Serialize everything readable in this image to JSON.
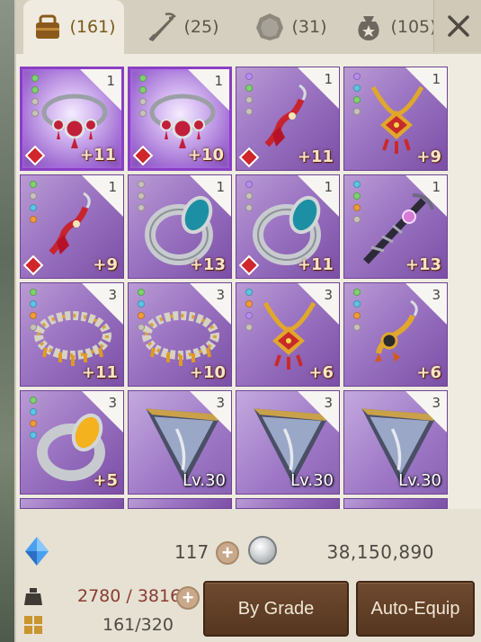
{
  "tabs": [
    {
      "icon": "bag-icon",
      "count": "(161)",
      "active": true
    },
    {
      "icon": "weapon-icon",
      "count": "(25)",
      "active": false
    },
    {
      "icon": "emblem-icon",
      "count": "(31)",
      "active": false
    },
    {
      "icon": "pouch-icon",
      "count": "(105)",
      "active": false
    }
  ],
  "items": [
    {
      "kind": "necklace",
      "qty": "1",
      "enh": "+11",
      "dots": [
        "#7fd36f",
        "#7fd36f",
        "#c9c2bc",
        "#c9c2bc"
      ],
      "gem": true,
      "selected": true
    },
    {
      "kind": "necklace",
      "qty": "1",
      "enh": "+10",
      "dots": [
        "#7fd36f",
        "#7fd36f",
        "#c9c2bc",
        "#c9c2bc"
      ],
      "gem": true,
      "selected": true
    },
    {
      "kind": "earring",
      "qty": "1",
      "enh": "+11",
      "dots": [
        "#b98cf4",
        "#7fd36f",
        "#c9c2bc",
        "#c9c2bc"
      ],
      "gem": true,
      "selected": false
    },
    {
      "kind": "pendant",
      "qty": "1",
      "enh": "+9",
      "dots": [
        "#b98cf4",
        "#5cc6e6",
        "#7fd36f",
        "#c9c2bc"
      ],
      "gem": false,
      "selected": false
    },
    {
      "kind": "earring",
      "qty": "1",
      "enh": "+9",
      "dots": [
        "#7fd36f",
        "#c9c2bc",
        "#5cc6e6",
        "#f39a3c"
      ],
      "gem": true,
      "selected": false
    },
    {
      "kind": "ring",
      "qty": "1",
      "enh": "+13",
      "dots": [
        "#c9c2bc",
        "#c9c2bc",
        "#c9c2bc"
      ],
      "gem": false,
      "selected": false
    },
    {
      "kind": "ring",
      "qty": "1",
      "enh": "+11",
      "dots": [
        "#b98cf4",
        "#c9c2bc",
        "#c9c2bc"
      ],
      "gem": true,
      "selected": false
    },
    {
      "kind": "staff",
      "qty": "1",
      "enh": "+13",
      "dots": [
        "#5cc6e6",
        "#7fd36f",
        "#f39a3c",
        "#c9c2bc"
      ],
      "gem": false,
      "selected": false
    },
    {
      "kind": "bracelet",
      "qty": "3",
      "enh": "+11",
      "dots": [
        "#7fd36f",
        "#5cc6e6",
        "#f39a3c",
        "#c9c2bc"
      ],
      "gem": false,
      "selected": false
    },
    {
      "kind": "bracelet",
      "qty": "3",
      "enh": "+10",
      "dots": [
        "#7fd36f",
        "#5cc6e6",
        "#f39a3c",
        "#c9c2bc"
      ],
      "gem": false,
      "selected": false
    },
    {
      "kind": "pendant",
      "qty": "3",
      "enh": "+6",
      "dots": [
        "#5cc6e6",
        "#f39a3c",
        "#b98cf4",
        "#c9c2bc"
      ],
      "gem": false,
      "selected": false
    },
    {
      "kind": "earring-gold",
      "qty": "3",
      "enh": "+6",
      "dots": [
        "#7fd36f",
        "#5cc6e6",
        "#f39a3c",
        "#c9c2bc"
      ],
      "gem": false,
      "selected": false
    },
    {
      "kind": "ring-gold",
      "qty": "3",
      "enh": "+5",
      "dots": [
        "#7fd36f",
        "#5cc6e6",
        "#f39a3c",
        "#5cc6e6"
      ],
      "gem": false,
      "selected": false
    },
    {
      "kind": "piece",
      "qty": "3",
      "lvl": "Lv.30",
      "dots": [],
      "gem": false,
      "selected": false
    },
    {
      "kind": "piece",
      "qty": "3",
      "lvl": "Lv.30",
      "dots": [],
      "gem": false,
      "selected": false
    },
    {
      "kind": "piece",
      "qty": "3",
      "lvl": "Lv.30",
      "dots": [],
      "gem": false,
      "selected": false
    }
  ],
  "currency": {
    "crystal_icon": "blue-crystal-icon",
    "crystal_count": "117",
    "coin_icon": "silver-coin-icon",
    "silver": "38,150,890"
  },
  "weight": "2780 / 3816",
  "slots": "161/320",
  "buttons": {
    "by_grade": "By Grade",
    "auto_equip": "Auto-Equip"
  }
}
